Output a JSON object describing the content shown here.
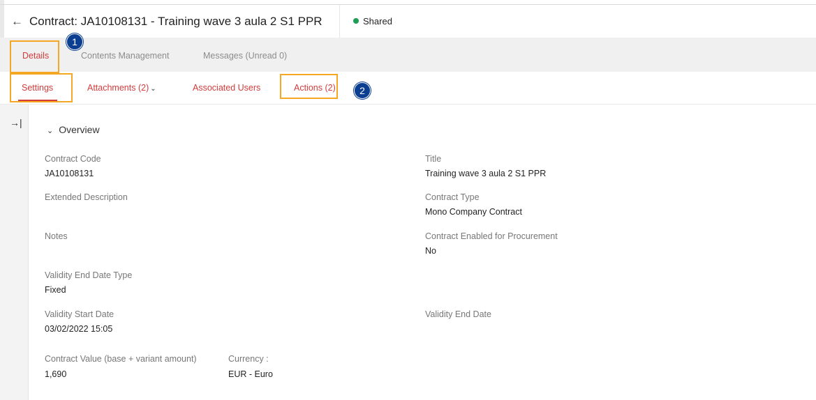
{
  "header": {
    "back_icon": "←",
    "title": "Contract: JA10108131 - Training wave 3 aula 2 S1 PPR",
    "status": "Shared",
    "status_color": "#1f9d55"
  },
  "tabs": [
    {
      "label": "Details"
    },
    {
      "label": "Contents Management"
    },
    {
      "label": "Messages (Unread 0)"
    }
  ],
  "subnav": {
    "settings": "Settings",
    "attachments": "Attachments (2)",
    "associated_users": "Associated Users",
    "actions": "Actions (2)"
  },
  "annotations": {
    "badge1": "1",
    "badge2": "2",
    "highlight_color": "#f5a623"
  },
  "sidebar": {
    "collapse_icon": "→|"
  },
  "overview": {
    "title": "Overview",
    "fields": {
      "contract_code": {
        "label": "Contract Code",
        "value": "JA10108131"
      },
      "title": {
        "label": "Title",
        "value": "Training wave 3 aula 2 S1 PPR"
      },
      "extended_description": {
        "label": "Extended Description",
        "value": ""
      },
      "contract_type": {
        "label": "Contract Type",
        "value": "Mono Company Contract"
      },
      "notes": {
        "label": "Notes",
        "value": ""
      },
      "procurement": {
        "label": "Contract Enabled for Procurement",
        "value": "No"
      },
      "validity_end_date_type": {
        "label": "Validity End Date Type",
        "value": "Fixed"
      },
      "validity_start_date": {
        "label": "Validity Start Date",
        "value": "03/02/2022 15:05"
      },
      "validity_end_date": {
        "label": "Validity End Date",
        "value": ""
      },
      "contract_value": {
        "label": "Contract Value (base + variant amount)",
        "value": "1,690"
      },
      "currency": {
        "label": "Currency :",
        "value": "EUR - Euro"
      }
    }
  },
  "colors": {
    "accent": "#d13b3b",
    "badge": "#0b3d91"
  }
}
